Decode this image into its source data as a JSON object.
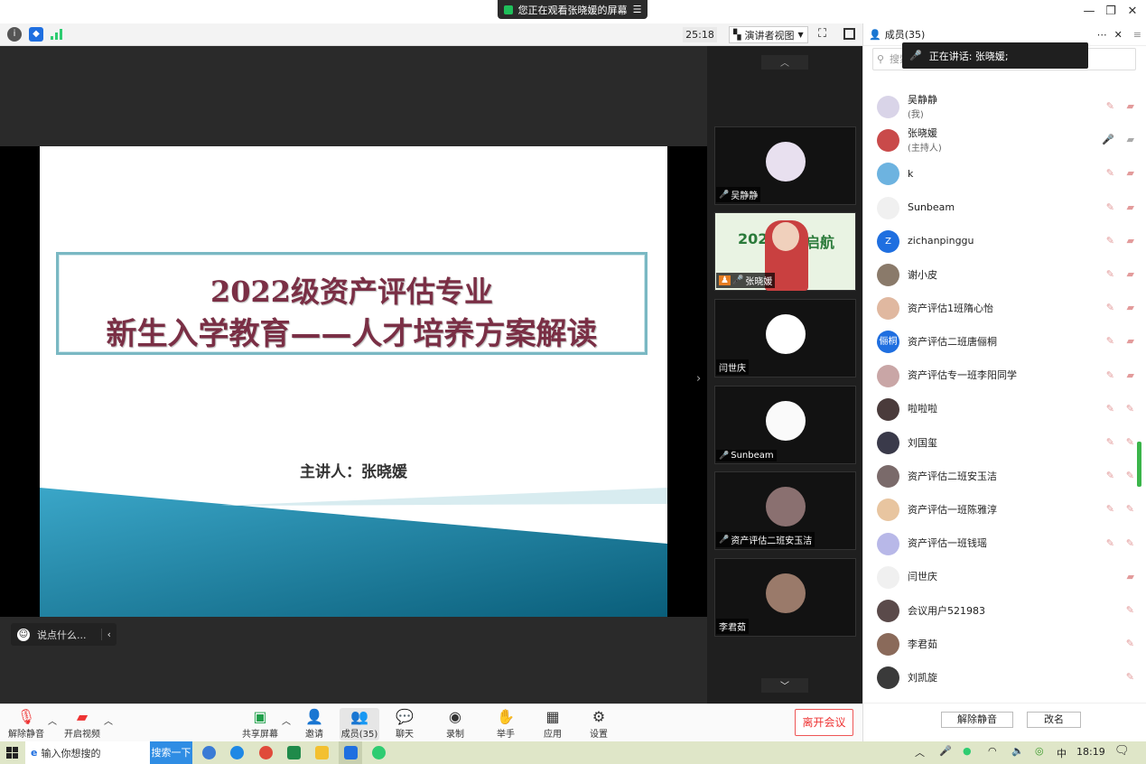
{
  "share_banner": "您正在观看张晓媛的屏幕",
  "toolbar": {
    "timer": "25:18",
    "view_mode": "演讲者视图"
  },
  "slide": {
    "title_line1": "2022级资产评估专业",
    "title_line2": "新生入学教育——人才培养方案解读",
    "presenter": "主讲人：张晓媛"
  },
  "chat_placeholder": "说点什么...",
  "gallery": [
    {
      "name": "吴静静",
      "muted": true
    },
    {
      "name": "张晓媛",
      "muted": false,
      "slide_text": "2022",
      "slide_text2": "启航"
    },
    {
      "name": "闫世庆",
      "muted": false
    },
    {
      "name": "Sunbeam",
      "muted": true
    },
    {
      "name": "资产评估二班安玉洁",
      "muted": true
    },
    {
      "name": "李君茹",
      "muted": false
    }
  ],
  "bottom_bar": {
    "unmute": "解除静音",
    "video": "开启视频",
    "share": "共享屏幕",
    "invite": "邀请",
    "members": "成员(35)",
    "chat": "聊天",
    "record": "录制",
    "raise_hand": "举手",
    "apps": "应用",
    "settings": "设置",
    "leave": "离开会议"
  },
  "panel": {
    "title": "成员(35)",
    "search_placeholder": "搜索",
    "speaking": "正在讲话: 张晓媛;",
    "members": [
      {
        "name": "吴静静",
        "sub": "(我)",
        "avatar_color": "#d9d4e8"
      },
      {
        "name": "张晓媛",
        "sub": "(主持人)",
        "avatar_color": "#c94a4a"
      },
      {
        "name": "k",
        "sub": "",
        "avatar_color": "#6db3e0"
      },
      {
        "name": "Sunbeam",
        "sub": "",
        "avatar_color": "#f0f0f0"
      },
      {
        "name": "zichanpinggu",
        "sub": "",
        "avatar_color": "#1f6fe0",
        "initial": "Z"
      },
      {
        "name": "谢小皮",
        "sub": "",
        "avatar_color": "#8a7a6a"
      },
      {
        "name": "资产评估1班隋心怡",
        "sub": "",
        "avatar_color": "#e0b8a0"
      },
      {
        "name": "资产评估二班唐俪桐",
        "sub": "",
        "avatar_color": "#1f6fe0",
        "initial": "俪桐"
      },
      {
        "name": "资产评估专一班李阳同学",
        "sub": "",
        "avatar_color": "#c9a6a6"
      },
      {
        "name": "啦啦啦",
        "sub": "",
        "avatar_color": "#4a3b3b"
      },
      {
        "name": "刘国玺",
        "sub": "",
        "avatar_color": "#3a3a4a"
      },
      {
        "name": "资产评估二班安玉洁",
        "sub": "",
        "avatar_color": "#7a6a6a"
      },
      {
        "name": "资产评估一班陈雅淳",
        "sub": "",
        "avatar_color": "#e8c5a0"
      },
      {
        "name": "资产评估一班钱瑶",
        "sub": "",
        "avatar_color": "#b8b8e8"
      },
      {
        "name": "闫世庆",
        "sub": "",
        "avatar_color": "#f0f0f0"
      },
      {
        "name": "会议用户521983",
        "sub": "",
        "avatar_color": "#5a4a4a"
      },
      {
        "name": "李君茹",
        "sub": "",
        "avatar_color": "#8a6a5a"
      },
      {
        "name": "刘凯旋",
        "sub": "",
        "avatar_color": "#3a3a3a"
      }
    ],
    "unmute_all": "解除静音",
    "rename": "改名"
  },
  "taskbar": {
    "search_text": "输入你想搜的",
    "search_button": "搜索一下",
    "ime": "中",
    "time": "18:19"
  }
}
